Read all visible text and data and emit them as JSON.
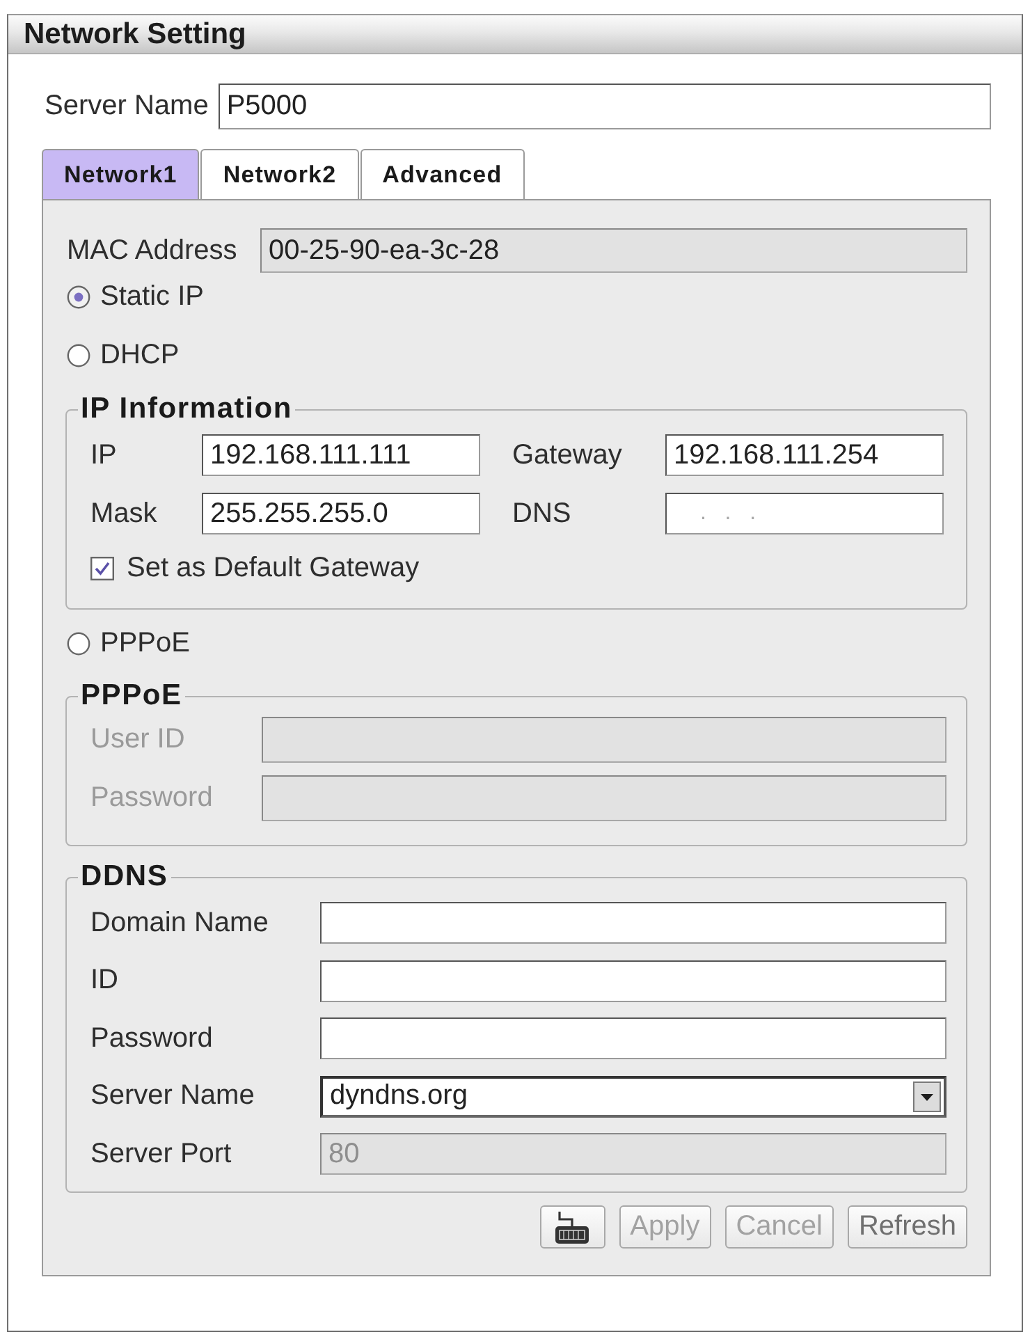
{
  "window": {
    "title": "Network Setting"
  },
  "server_name": {
    "label": "Server Name",
    "value": "P5000"
  },
  "tabs": [
    {
      "label": "Network1",
      "selected": true
    },
    {
      "label": "Network2",
      "selected": false
    },
    {
      "label": "Advanced",
      "selected": false
    }
  ],
  "mac_address": {
    "label": "MAC Address",
    "value": "00-25-90-ea-3c-28",
    "read_only": true
  },
  "static_ip": {
    "label": "Static IP",
    "selected": true
  },
  "dhcp": {
    "label": "DHCP",
    "selected": false
  },
  "ip_information": {
    "title": "IP Information",
    "fields": [
      {
        "label": "IP",
        "value": "192.168.111.111"
      },
      {
        "label": "Gateway",
        "value": "192.168.111.254"
      },
      {
        "label": "Mask",
        "value": "255.255.255.0"
      },
      {
        "label": "DNS",
        "placeholder": ".   .   ."
      }
    ],
    "default_gateway": {
      "label": "Set as Default Gateway",
      "checked": true
    }
  },
  "pppoe": {
    "label": "PPPoE",
    "selected": false
  },
  "pppoe_settings": {
    "title": "PPPoE",
    "disabled": true,
    "fields": [
      {
        "label": "User ID"
      },
      {
        "label": "Password"
      }
    ]
  },
  "ddns": {
    "title": "DDNS",
    "fields": [
      {
        "kind": "text",
        "label": "Domain Name",
        "disabled": false
      },
      {
        "kind": "text",
        "label": "ID",
        "disabled": false
      },
      {
        "kind": "text",
        "label": "Password",
        "disabled": false
      },
      {
        "kind": "select",
        "label": "Server Name",
        "value": "dyndns.org",
        "disabled": false
      },
      {
        "kind": "text",
        "label": "Server Port",
        "value": "80",
        "disabled": true
      }
    ]
  },
  "buttons": [
    {
      "kind": "keyboard",
      "disabled": false
    },
    {
      "kind": "text",
      "label": "Apply",
      "disabled": true
    },
    {
      "kind": "text",
      "label": "Cancel",
      "disabled": true
    },
    {
      "kind": "text",
      "label": "Refresh",
      "disabled": false
    }
  ]
}
